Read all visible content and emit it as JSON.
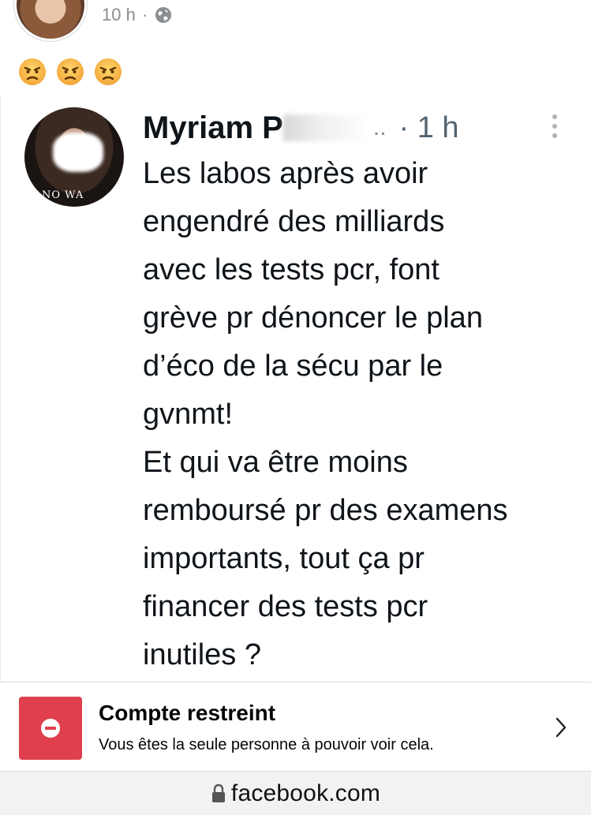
{
  "post": {
    "time": "10 h",
    "separator": "·",
    "privacy_icon": "globe-icon",
    "reactions": [
      "😠",
      "😠",
      "😠"
    ]
  },
  "tweet": {
    "author_visible": "Myriam P",
    "ellipsis": "..",
    "time": "· 1 h",
    "more_icon": "vertical-dots-icon",
    "avatar_shirt_text": "NO WA",
    "lines": [
      "Les labos après avoir",
      "engendré des milliards",
      "avec les tests pcr, font",
      "grève pr dénoncer le plan",
      "d’éco de la sécu par le",
      "gvnmt!",
      "Et qui va être moins",
      "remboursé pr des examens",
      "importants, tout ça pr",
      "financer des tests pcr",
      "inutiles ?"
    ]
  },
  "restricted": {
    "title": "Compte restreint",
    "subtitle": "Vous êtes la seule personne à pouvoir voir cela.",
    "icon": "restricted-minus-icon",
    "accent_color": "#e0404d"
  },
  "address_bar": {
    "url": "facebook.com",
    "icon": "lock-icon"
  }
}
